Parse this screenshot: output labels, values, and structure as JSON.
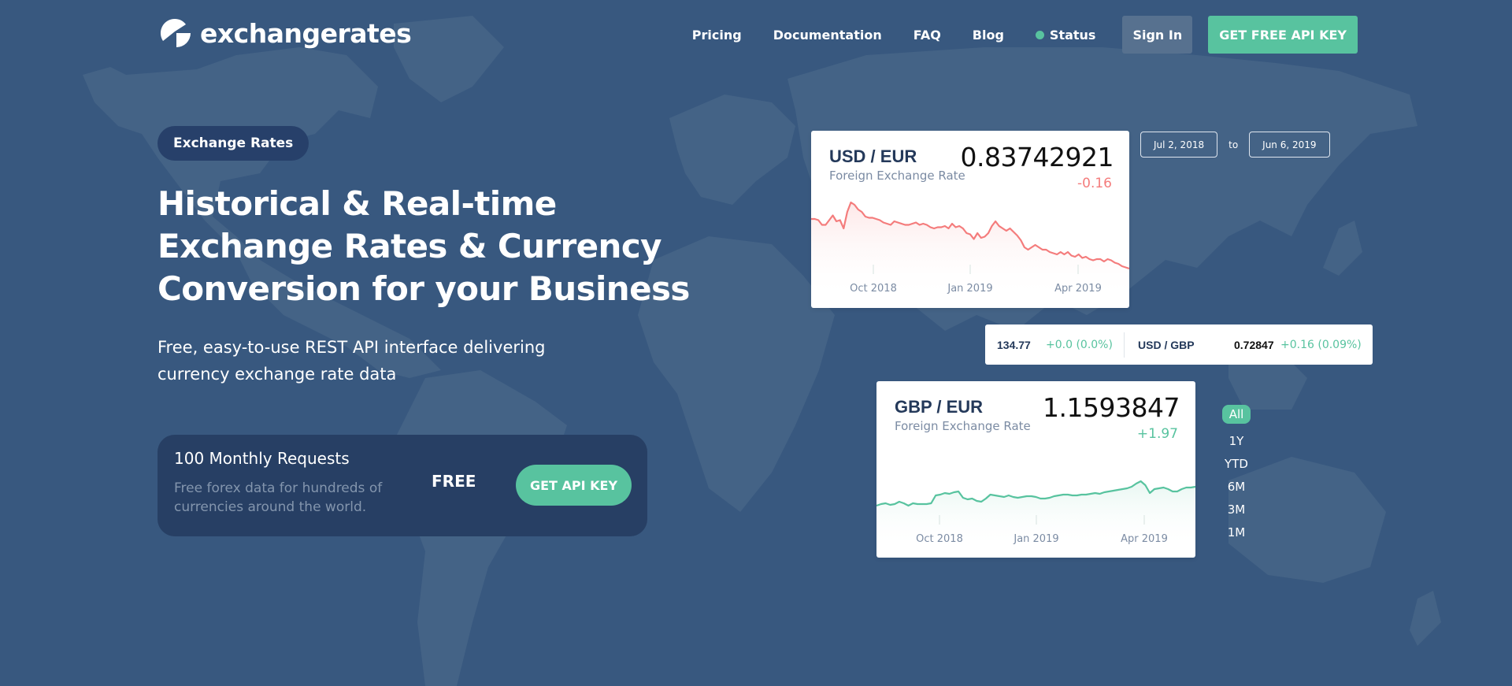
{
  "brand": {
    "name": "exchangerates"
  },
  "nav": {
    "links": [
      "Pricing",
      "Documentation",
      "FAQ",
      "Blog"
    ],
    "status_label": "Status",
    "signin_label": "Sign In",
    "cta_label": "GET FREE API KEY"
  },
  "colors": {
    "background": "#38587f",
    "accent": "#58c39f",
    "negative": "#f47c7c",
    "dark_panel": "#273f64"
  },
  "hero": {
    "pill": "Exchange Rates",
    "headline": "Historical & Real-time Exchange Rates & Currency Conversion for your Business",
    "subline": "Free, easy-to-use REST API interface delivering currency exchange rate data"
  },
  "plan": {
    "title": "100 Monthly Requests",
    "description": "Free forex data for hundreds of currencies around the world.",
    "price": "FREE",
    "cta_label": "GET API KEY"
  },
  "date_range": {
    "from": "Jul 2, 2018",
    "to_label": "to",
    "to": "Jun 6, 2019"
  },
  "ticker": {
    "left_value": "134.77",
    "left_change": "+0.0 (0.0%)",
    "pair": "USD / GBP",
    "value": "0.72847",
    "change": "+0.16 (0.09%)"
  },
  "ranges": {
    "options": [
      "All",
      "1Y",
      "YTD",
      "6M",
      "3M",
      "1M"
    ],
    "selected": "All"
  },
  "chart_data": [
    {
      "type": "area",
      "title": "USD / EUR",
      "subtitle": "Foreign Exchange Rate",
      "current_value": "0.83742921",
      "change": "-0.16",
      "trend": "negative",
      "x_ticks": [
        "Oct 2018",
        "Jan 2019",
        "Apr 2019"
      ],
      "x_range": [
        "Jul 2, 2018",
        "Jun 6, 2019"
      ],
      "series": [
        {
          "name": "USD/EUR",
          "values": [
            0.86,
            0.86,
            0.859,
            0.855,
            0.855,
            0.859,
            0.863,
            0.858,
            0.859,
            0.852,
            0.866,
            0.874,
            0.872,
            0.868,
            0.866,
            0.862,
            0.861,
            0.861,
            0.86,
            0.859,
            0.857,
            0.856,
            0.855,
            0.858,
            0.857,
            0.856,
            0.855,
            0.855,
            0.856,
            0.857,
            0.855,
            0.856,
            0.855,
            0.853,
            0.852,
            0.853,
            0.853,
            0.854,
            0.852,
            0.856,
            0.853,
            0.854,
            0.852,
            0.848,
            0.847,
            0.843,
            0.848,
            0.844,
            0.845,
            0.848,
            0.854,
            0.858,
            0.854,
            0.852,
            0.85,
            0.852,
            0.849,
            0.846,
            0.842,
            0.836,
            0.834,
            0.836,
            0.838,
            0.836,
            0.834,
            0.834,
            0.832,
            0.831,
            0.83,
            0.832,
            0.83,
            0.832,
            0.829,
            0.828,
            0.83,
            0.827,
            0.828,
            0.826,
            0.825,
            0.826,
            0.826,
            0.824,
            0.826,
            0.825,
            0.823,
            0.822,
            0.82,
            0.819,
            0.818
          ]
        }
      ],
      "ylim": [
        0.8,
        0.88
      ]
    },
    {
      "type": "area",
      "title": "GBP / EUR",
      "subtitle": "Foreign Exchange Rate",
      "current_value": "1.1593847",
      "change": "+1.97",
      "trend": "positive",
      "x_ticks": [
        "Oct 2018",
        "Jan 2019",
        "Apr 2019"
      ],
      "x_range": [
        "Jul 2, 2018",
        "Jun 6, 2019"
      ],
      "series": [
        {
          "name": "GBP/EUR",
          "values": [
            1.124,
            1.126,
            1.127,
            1.125,
            1.126,
            1.129,
            1.127,
            1.124,
            1.127,
            1.126,
            1.126,
            1.126,
            1.127,
            1.137,
            1.138,
            1.14,
            1.139,
            1.141,
            1.142,
            1.134,
            1.132,
            1.133,
            1.13,
            1.129,
            1.133,
            1.138,
            1.137,
            1.136,
            1.135,
            1.137,
            1.135,
            1.134,
            1.135,
            1.136,
            1.136,
            1.135,
            1.133,
            1.133,
            1.134,
            1.136,
            1.137,
            1.138,
            1.138,
            1.137,
            1.137,
            1.138,
            1.138,
            1.139,
            1.14,
            1.139,
            1.141,
            1.142,
            1.143,
            1.144,
            1.145,
            1.146,
            1.148,
            1.152,
            1.155,
            1.15,
            1.14,
            1.145,
            1.146,
            1.147,
            1.145,
            1.142,
            1.142,
            1.145,
            1.147,
            1.147,
            1.148
          ]
        }
      ],
      "ylim": [
        1.08,
        1.2
      ]
    }
  ]
}
